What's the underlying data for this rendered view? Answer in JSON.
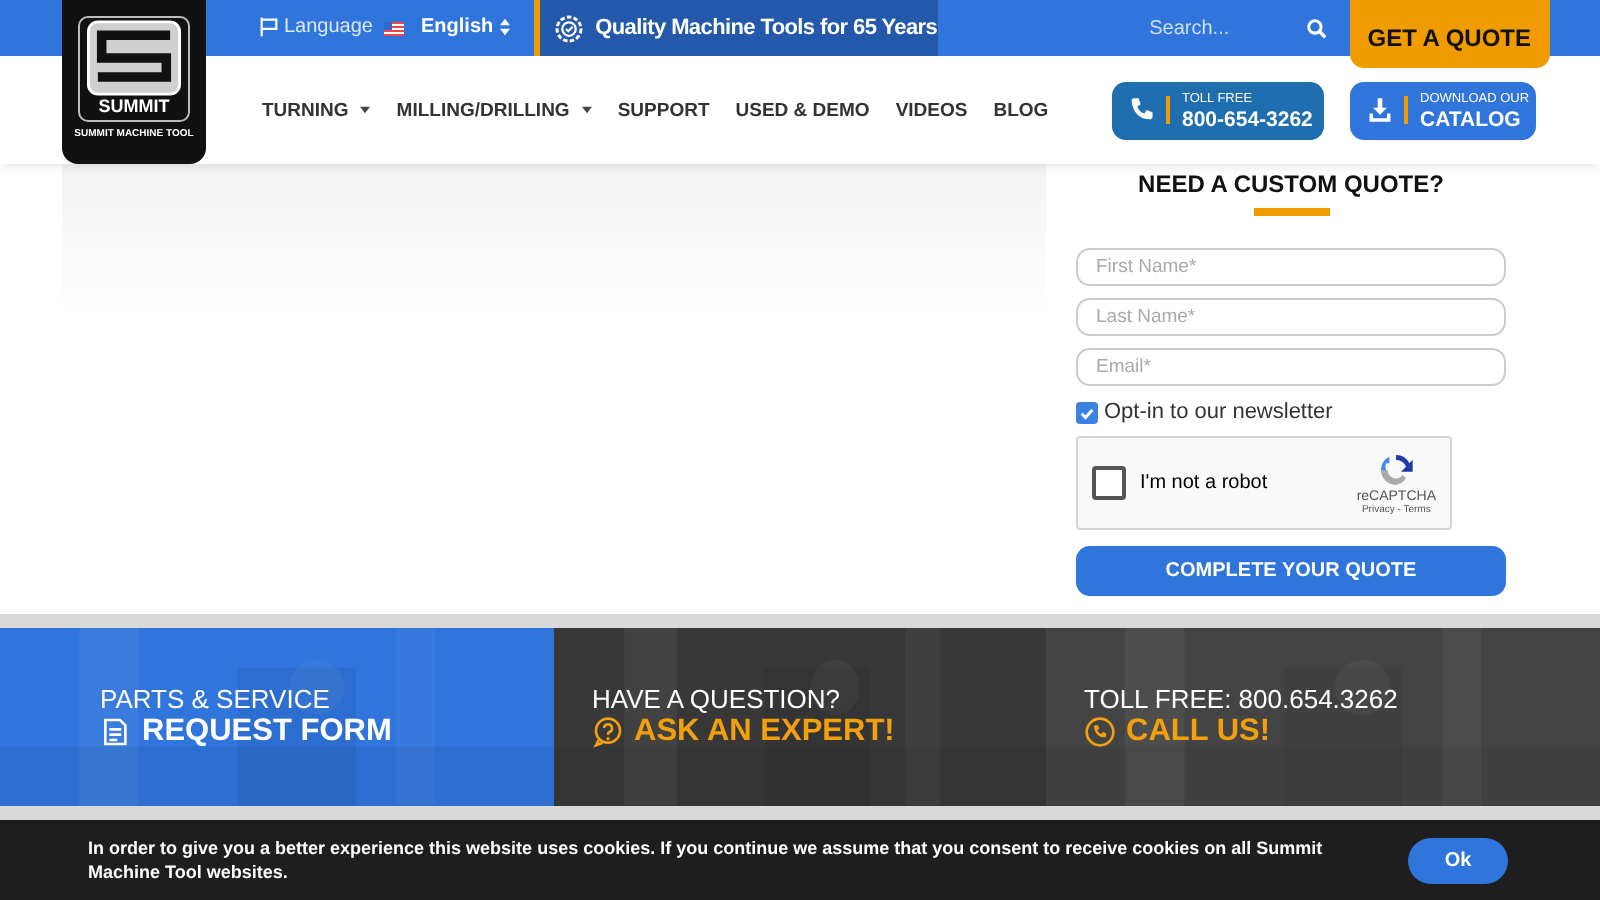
{
  "logo": {
    "brand": "SUMMIT",
    "tagline": "SUMMIT MACHINE TOOL"
  },
  "top_bar": {
    "language_label": "Language",
    "language_value": "English",
    "slogan": "Quality Machine Tools for 65 Years",
    "search": {
      "placeholder": "Search..."
    },
    "quote_button": "GET A QUOTE"
  },
  "nav": [
    {
      "label": "TURNING",
      "dropdown": true
    },
    {
      "label": "MILLING/DRILLING",
      "dropdown": true
    },
    {
      "label": "SUPPORT",
      "dropdown": false
    },
    {
      "label": "USED & DEMO",
      "dropdown": false
    },
    {
      "label": "VIDEOS",
      "dropdown": false
    },
    {
      "label": "BLOG",
      "dropdown": false
    }
  ],
  "header_buttons": [
    {
      "kind": "phone",
      "small": "TOLL FREE",
      "big": "800-654-3262"
    },
    {
      "kind": "download",
      "small": "DOWNLOAD OUR",
      "big": "CATALOG"
    }
  ],
  "quote_form": {
    "title": "NEED A CUSTOM QUOTE?",
    "fields": [
      {
        "placeholder": "First Name*"
      },
      {
        "placeholder": "Last Name*"
      },
      {
        "placeholder": "Email*"
      }
    ],
    "newsletter": {
      "label": "Opt-in to our newsletter",
      "checked": true
    },
    "captcha": {
      "label": "I'm not a robot",
      "brand": "reCAPTCHA",
      "links": "Privacy - Terms",
      "checked": false
    },
    "submit": "COMPLETE YOUR QUOTE"
  },
  "cta_panels": [
    {
      "kind": "form",
      "top": "PARTS & SERVICE",
      "big": "REQUEST FORM"
    },
    {
      "kind": "question",
      "top": "HAVE A QUESTION?",
      "big": "ASK AN EXPERT!"
    },
    {
      "kind": "phone",
      "top": "TOLL FREE: 800.654.3262",
      "big": "CALL US!"
    }
  ],
  "cookie_bar": {
    "text": "In order to give you a better experience this website uses cookies. If you continue we assume that you consent to receive cookies on all Summit Machine Tool websites.",
    "button": "Ok"
  }
}
